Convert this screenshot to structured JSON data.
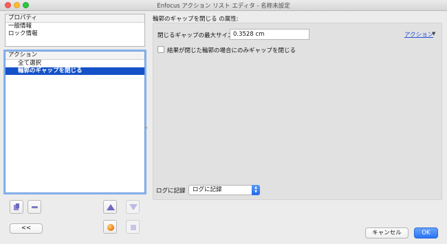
{
  "window": {
    "title": "Enfocus アクション リスト エディタ - 名称未設定"
  },
  "properties_panel": {
    "header": "プロパティ",
    "items": [
      "一般情報",
      "ロック情報"
    ]
  },
  "actions_panel": {
    "header": "アクション",
    "items": [
      {
        "label": "全て選択",
        "selected": false
      },
      {
        "label": "輪郭のギャップを閉じる",
        "selected": true
      }
    ]
  },
  "toolbar": {
    "back_label": "<<"
  },
  "detail": {
    "heading": "輪郭のギャップを閉じる の属性:",
    "max_gap_label": "閉じるギャップの最大サイズ",
    "max_gap_value": "0.3528 cm",
    "action_link": "アクション",
    "checkbox_label": "結果が閉じた輪郭の場合にのみギャップを閉じる",
    "checkbox_checked": false,
    "log_label": "ログに記録",
    "log_select_value": "ログに記録"
  },
  "footer": {
    "cancel_label": "キャンセル",
    "ok_label": "OK"
  },
  "colors": {
    "selection": "#1552c8",
    "ok_button": "#2a74f5",
    "link": "#2450d8"
  },
  "icons": [
    "duplicate-icon",
    "remove-icon",
    "move-up-icon",
    "move-down-icon",
    "record-icon",
    "stop-icon"
  ]
}
